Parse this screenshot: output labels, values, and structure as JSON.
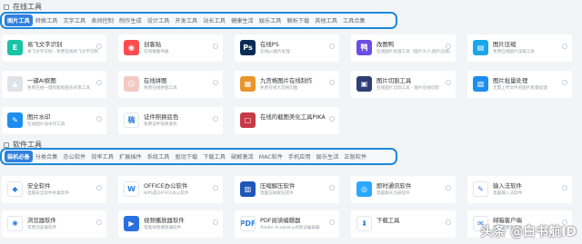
{
  "online": {
    "title": "在线工具",
    "tabs": [
      "图片工具",
      "转换工具",
      "文字工具",
      "表间控制",
      "制作生成",
      "设计工具",
      "开发工具",
      "站长工具",
      "健康生活",
      "娱乐工具",
      "解析下载",
      "其他工具",
      "工具合集"
    ]
  },
  "online_cards": [
    {
      "title": "易飞文字识别",
      "desc": "易飞文字识别 - 免费在线易飞文字识别",
      "icon": "text-recognition-icon",
      "color": "#18c4a5",
      "glyph": "E"
    },
    {
      "title": "创客贴",
      "desc": "在线做图神器",
      "icon": "chuangketie-icon",
      "color": "#ff4d4f",
      "glyph": "◉"
    },
    {
      "title": "在线PS",
      "desc": "在线ps图片处理",
      "icon": "photoshop-icon",
      "color": "#0a2b56",
      "glyph": "Ps"
    },
    {
      "title": "改图鸭",
      "desc": "在线图片处理工具（图片大小,图片压缩）",
      "icon": "gaituya-icon",
      "color": "#6b4de6",
      "glyph": "鸭"
    },
    {
      "title": "图片压缩",
      "desc": "免费在线图片压缩工具",
      "icon": "image-compress-icon",
      "color": "#1aa6e8",
      "glyph": "▤"
    },
    {
      "title": "一键AI抠图",
      "desc": "免费在线一键智能抠图去背景工具",
      "icon": "ai-cutout-icon",
      "color": "#dce3ea",
      "glyph": "▲"
    },
    {
      "title": "在线拼图",
      "desc": "免费在线拼图工具",
      "icon": "collage-icon",
      "color": "#f2c9c3",
      "glyph": "☺"
    },
    {
      "title": "九宫格图片在线制作",
      "desc": "免费在线九宫格切图",
      "icon": "nine-grid-icon",
      "color": "#e8962c",
      "glyph": "▦"
    },
    {
      "title": "图片切割工具",
      "desc": "在线图片切割工具 - 图片在线切割",
      "icon": "image-split-icon",
      "color": "#2d3f77",
      "glyph": "▣"
    },
    {
      "title": "图片批量处理",
      "desc": "无需上传文件的图片批量处理",
      "icon": "batch-process-icon",
      "color": "#1d8df0",
      "glyph": "▧"
    },
    {
      "title": "图片水印",
      "desc": "在线图片加水印工具",
      "icon": "watermark-icon",
      "color": "#1d8df0",
      "glyph": "✎"
    },
    {
      "title": "证件照换底色",
      "desc": "免费证件照换底色",
      "icon": "id-photo-icon",
      "color": "#ffffff",
      "glyph": "稿"
    },
    {
      "title": "在线的截图美化工具PIKA",
      "desc": "",
      "icon": "pika-icon",
      "color": "#c63a46",
      "glyph": "▢"
    }
  ],
  "software": {
    "title": "软件工具",
    "tabs": [
      "装机必备",
      "分类合集",
      "办公软件",
      "效率工具",
      "扩展插件",
      "系统工具",
      "驱动下载",
      "下载工具",
      "破解激活",
      "MAC软件",
      "手机应用",
      "娱乐生活",
      "正版软件"
    ]
  },
  "software_cards": [
    {
      "title": "安全软件",
      "desc": "电脑安全软件杀毒软件",
      "icon": "security-shield-icon",
      "color": "#ffffff",
      "glyph": "◆"
    },
    {
      "title": "OFFICE办公软件",
      "desc": "WPS是OFFICE办公软件",
      "icon": "office-icon",
      "color": "#ffffff",
      "glyph": "W"
    },
    {
      "title": "压缩解压软件",
      "desc": "电脑压缩解压软件",
      "icon": "compress-archive-icon",
      "color": "#1f57b8",
      "glyph": "▥"
    },
    {
      "title": "即时通讯软件",
      "desc": "电脑聊天沟通软件",
      "icon": "chat-icon",
      "color": "#2aa8ff",
      "glyph": "◎"
    },
    {
      "title": "输入法软件",
      "desc": "电脑输入法软件",
      "icon": "input-method-icon",
      "color": "#ffffff",
      "glyph": "✎"
    },
    {
      "title": "浏览器软件",
      "desc": "常用浏览器软件",
      "icon": "browser-icon",
      "color": "#ffffff",
      "glyph": "✺"
    },
    {
      "title": "视频播放器软件",
      "desc": "电脑视频播放器软件",
      "icon": "video-player-icon",
      "color": "#2a6fe0",
      "glyph": "▶"
    },
    {
      "title": "PDF阅读编辑器",
      "desc": "Adobe Acrobat pdf阅读编辑器",
      "icon": "pdf-icon",
      "color": "#ffffff",
      "glyph": "PDF"
    },
    {
      "title": "下载工具",
      "desc": "",
      "icon": "download-icon",
      "color": "#ffffff",
      "glyph": "⬇"
    },
    {
      "title": "邮箱客户端",
      "desc": "电脑邮箱客户端",
      "icon": "mail-icon",
      "color": "#ffffff",
      "glyph": "✉"
    }
  ],
  "watermark": "头条 @白书航ID"
}
